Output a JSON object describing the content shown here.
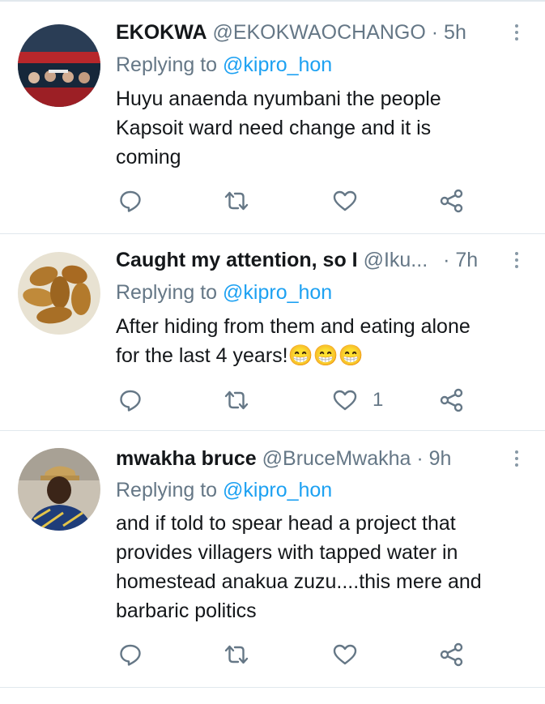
{
  "tweets": [
    {
      "name": "EKOKWA",
      "handle": "@EKOKWAOCHANGO",
      "time": "· 5h",
      "replying_prefix": "Replying to",
      "replying_handle": "@kipro_hon",
      "text_lines": [
        "Huyu anaenda nyumbani the people",
        "Kapsoit ward need change and it is",
        "coming"
      ],
      "like_count": ""
    },
    {
      "name": "Caught my attention, so I",
      "handle": "@Iku...",
      "time": "· 7h",
      "replying_prefix": "Replying to",
      "replying_handle": "@kipro_hon",
      "text_lines": [
        "After hiding from them and eating alone",
        "for the last 4 years!😁😁😁"
      ],
      "like_count": "1"
    },
    {
      "name": "mwakha bruce",
      "handle": "@BruceMwakha",
      "time": "· 9h",
      "replying_prefix": "Replying to",
      "replying_handle": "@kipro_hon",
      "text_lines": [
        "and if told to spear head a project that",
        "provides villagers with tapped water in",
        "homestead anakua zuzu....this mere and",
        "barbaric politics"
      ],
      "like_count": ""
    }
  ],
  "icons": [
    "comment-icon",
    "retweet-icon",
    "like-icon",
    "share-icon",
    "more-vertical-icon"
  ],
  "colors": {
    "link": "#1da1f2",
    "muted": "#657786",
    "text": "#14171a",
    "separator": "#e1e8ed"
  }
}
